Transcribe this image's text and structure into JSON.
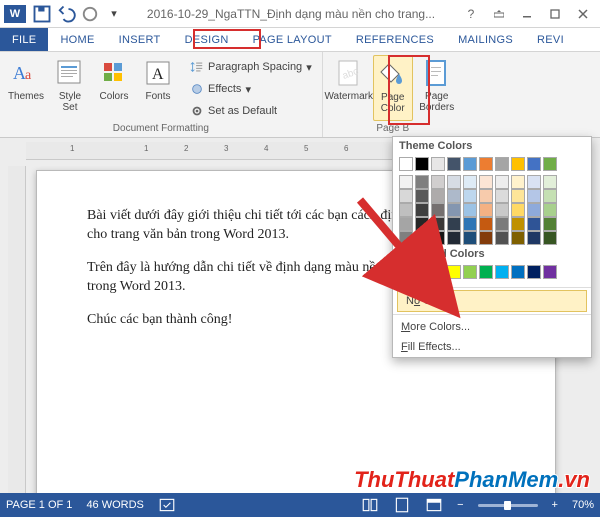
{
  "title": "2016-10-29_NgaTTN_Định dạng màu nền cho trang...",
  "tabs": {
    "file": "FILE",
    "home": "HOME",
    "insert": "INSERT",
    "design": "DESIGN",
    "page_layout": "PAGE LAYOUT",
    "references": "REFERENCES",
    "mailings": "MAILINGS",
    "review": "REVI"
  },
  "ribbon": {
    "themes": "Themes",
    "style_set": "Style\nSet",
    "colors": "Colors",
    "fonts": "Fonts",
    "paragraph_spacing": "Paragraph Spacing",
    "effects": "Effects",
    "set_default": "Set as Default",
    "watermark": "Watermark",
    "page_color": "Page\nColor",
    "page_borders": "Page\nBorders",
    "group_doc_formatting": "Document Formatting",
    "group_page_bg": "Page B"
  },
  "popup": {
    "theme_colors": "Theme Colors",
    "standard_colors": "Standard Colors",
    "no_color_pre": "N",
    "no_color_u": "o",
    "no_color_post": " Color",
    "more_colors_u": "M",
    "more_colors_post": "ore Colors...",
    "fill_effects_u": "F",
    "fill_effects_post": "ill Effects..."
  },
  "document": {
    "p1": "Bài viết dưới đây giới thiệu chi tiết tới các bạn cách định dạng màu nền cho trang văn bản trong Word 2013.",
    "p2": "Trên đây là hướng dẫn chi tiết về định dạng màu nền cho trang văn bản trong Word 2013.",
    "p3": "Chúc các bạn thành công!"
  },
  "status": {
    "page": "PAGE 1 OF 1",
    "words": "46 WORDS",
    "zoom": "70%"
  },
  "watermark": {
    "part1": "ThuThuat",
    "part2": "PhanMem",
    "part3": ".vn"
  },
  "colors": {
    "theme_row1": [
      "#ffffff",
      "#000000",
      "#e7e6e6",
      "#44546a",
      "#5b9bd5",
      "#ed7d31",
      "#a5a5a5",
      "#ffc000",
      "#4472c4",
      "#70ad47"
    ],
    "theme_shades": [
      [
        "#f2f2f2",
        "#7f7f7f",
        "#d0cece",
        "#d6dce4",
        "#deebf6",
        "#fbe5d5",
        "#ededed",
        "#fff2cc",
        "#d9e2f3",
        "#e2efd9"
      ],
      [
        "#d8d8d8",
        "#595959",
        "#aeabab",
        "#adb9ca",
        "#bdd7ee",
        "#f7cbac",
        "#dbdbdb",
        "#fee599",
        "#b4c6e7",
        "#c5e0b3"
      ],
      [
        "#bfbfbf",
        "#3f3f3f",
        "#757070",
        "#8496b0",
        "#9cc3e5",
        "#f4b183",
        "#c9c9c9",
        "#ffd965",
        "#8eaadb",
        "#a8d08d"
      ],
      [
        "#a5a5a5",
        "#262626",
        "#3a3838",
        "#323f4f",
        "#2e75b5",
        "#c55a11",
        "#7b7b7b",
        "#bf9000",
        "#2f5496",
        "#538135"
      ],
      [
        "#7f7f7f",
        "#0c0c0c",
        "#171616",
        "#222a35",
        "#1e4e79",
        "#833c0b",
        "#525252",
        "#7f6000",
        "#1f3864",
        "#375623"
      ]
    ],
    "standard": [
      "#c00000",
      "#ff0000",
      "#ffc000",
      "#ffff00",
      "#92d050",
      "#00b050",
      "#00b0f0",
      "#0070c0",
      "#002060",
      "#7030a0"
    ]
  }
}
